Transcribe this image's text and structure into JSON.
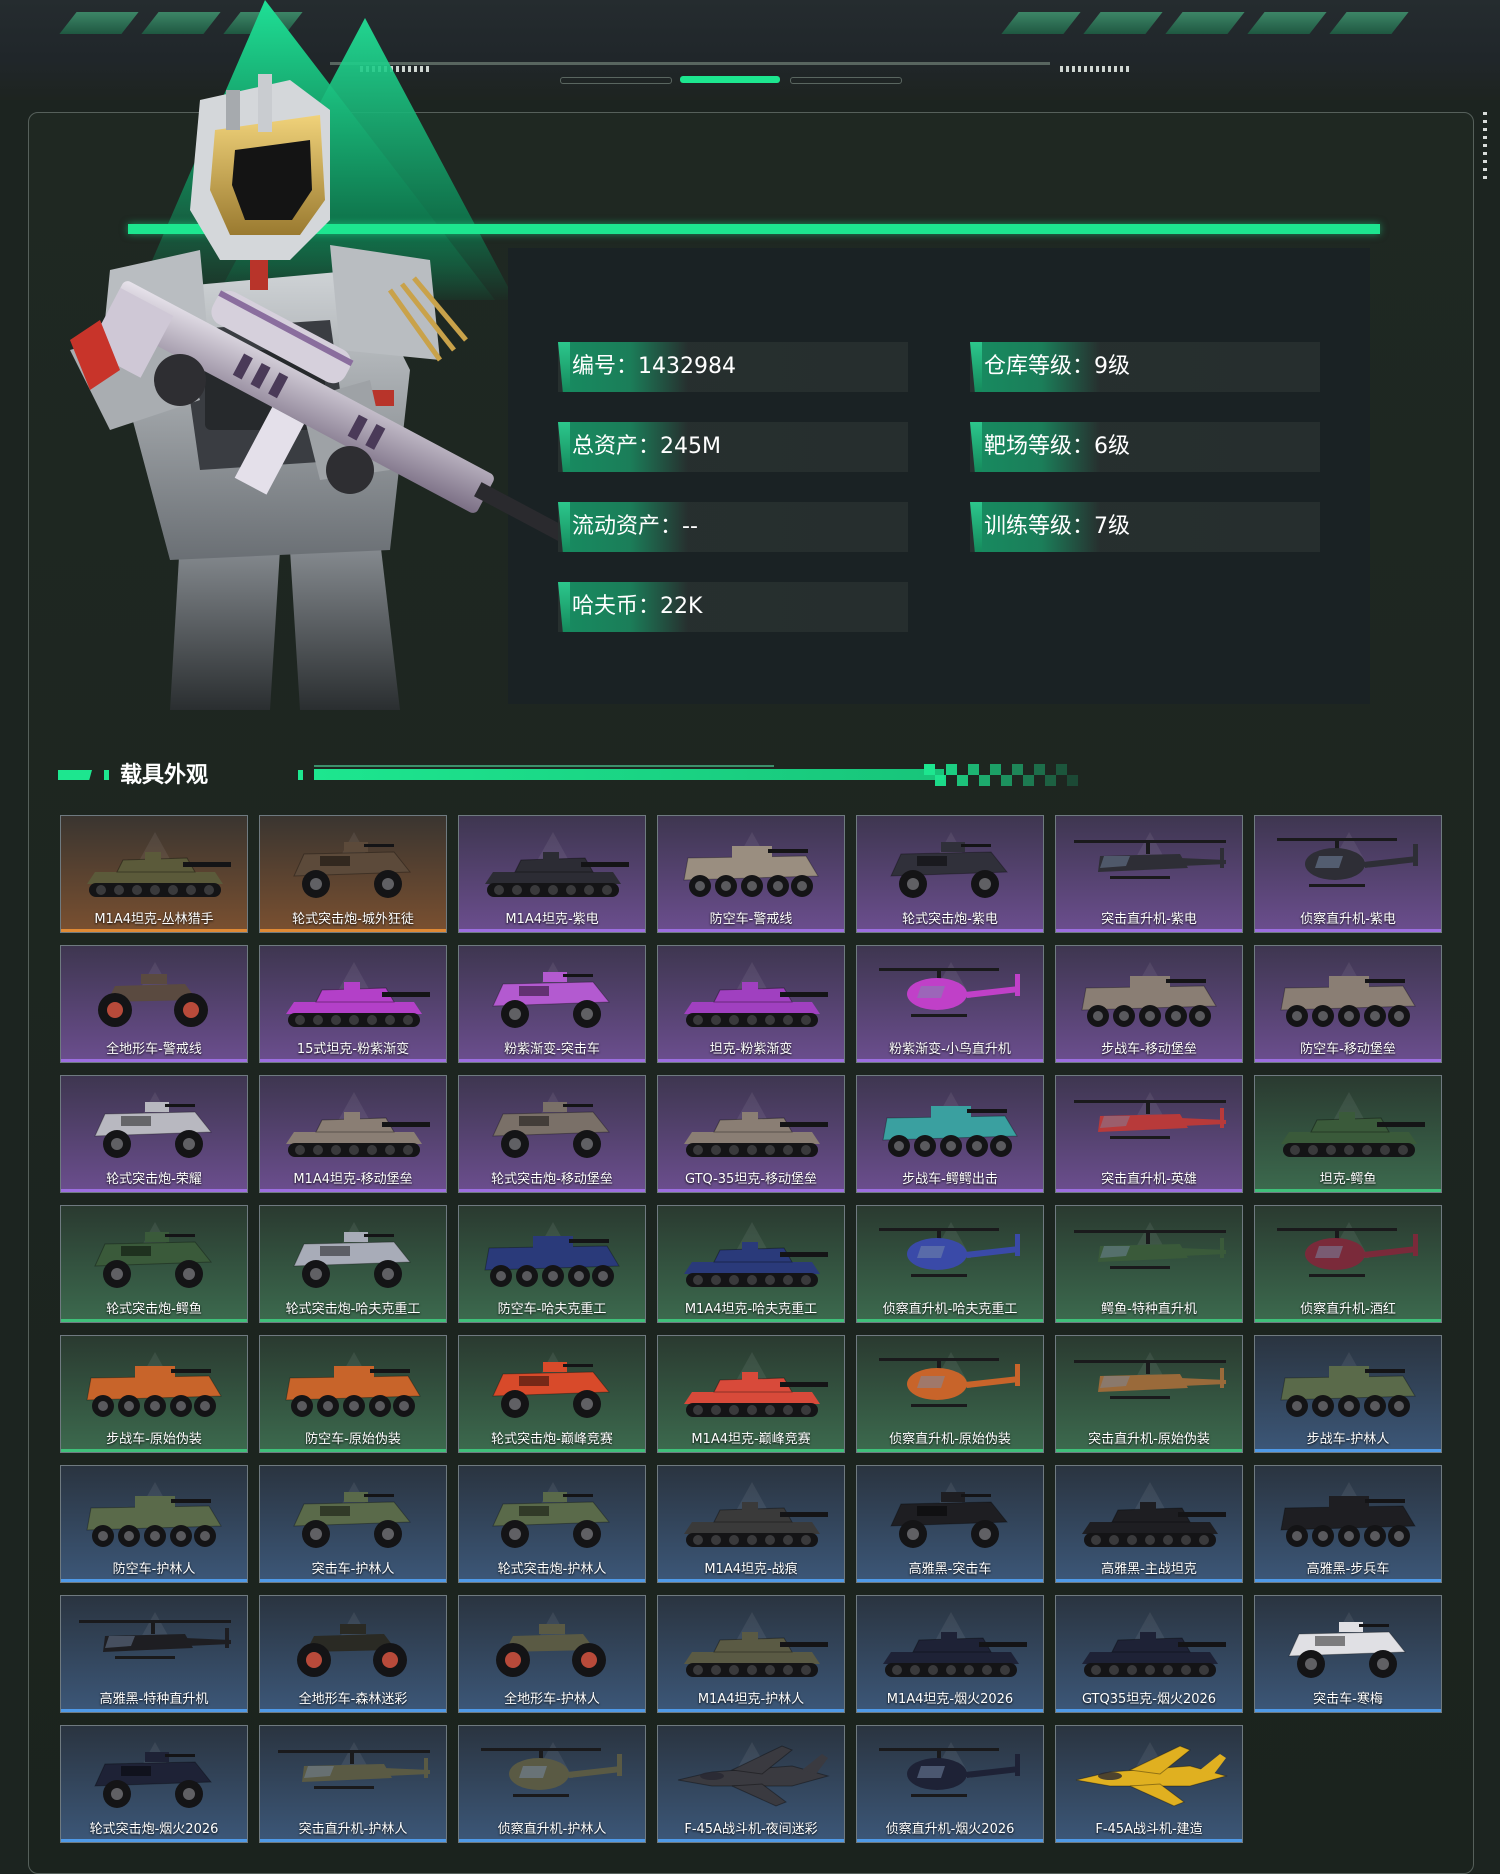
{
  "profile": {
    "stats": [
      {
        "label": "编号",
        "value": "1432984"
      },
      {
        "label": "仓库等级",
        "value": "9级"
      },
      {
        "label": "总资产",
        "value": "245M"
      },
      {
        "label": "靶场等级",
        "value": "6级"
      },
      {
        "label": "流动资产",
        "value": "--"
      },
      {
        "label": "训练等级",
        "value": "7级"
      },
      {
        "label": "哈夫币",
        "value": "22K"
      }
    ],
    "separator": "："
  },
  "section": {
    "title": "载具外观"
  },
  "colors": {
    "accent": "#1de68f",
    "rarity": {
      "orange": {
        "bg_top": "#3a3530",
        "bg_bottom": "#7a5030",
        "line": "#e08a35"
      },
      "purple": {
        "bg_top": "#3e3650",
        "bg_bottom": "#6b4e8e",
        "line": "#9c6ee0"
      },
      "green": {
        "bg_top": "#2a3a30",
        "bg_bottom": "#3c6a4e",
        "line": "#3fc07a"
      },
      "blue": {
        "bg_top": "#2a3440",
        "bg_bottom": "#3c5778",
        "line": "#4f9ae8"
      }
    }
  },
  "vehicles": [
    {
      "name": "M1A4坦克-丛林猎手",
      "rarity": "orange",
      "kind": "tank",
      "tint": "#5b5a3a"
    },
    {
      "name": "轮式突击炮-城外狂徒",
      "rarity": "orange",
      "kind": "armored",
      "tint": "#5c4a3a"
    },
    {
      "name": "M1A4坦克-紫电",
      "rarity": "purple",
      "kind": "tank",
      "tint": "#2c2c34"
    },
    {
      "name": "防空车-警戒线",
      "rarity": "purple",
      "kind": "apc",
      "tint": "#9a8e80"
    },
    {
      "name": "轮式突击炮-紫电",
      "rarity": "purple",
      "kind": "armored",
      "tint": "#30303a"
    },
    {
      "name": "突击直升机-紫电",
      "rarity": "purple",
      "kind": "heli",
      "tint": "#2e2e36"
    },
    {
      "name": "侦察直升机-紫电",
      "rarity": "purple",
      "kind": "heli_small",
      "tint": "#2e2e36"
    },
    {
      "name": "全地形车-警戒线",
      "rarity": "purple",
      "kind": "atv",
      "tint": "#5a4a40"
    },
    {
      "name": "15式坦克-粉紫渐变",
      "rarity": "purple",
      "kind": "tank",
      "tint": "#b340c8"
    },
    {
      "name": "粉紫渐变-突击车",
      "rarity": "purple",
      "kind": "armored",
      "tint": "#b35ad0"
    },
    {
      "name": "坦克-粉紫渐变",
      "rarity": "purple",
      "kind": "tank",
      "tint": "#a040c0"
    },
    {
      "name": "粉紫渐变-小鸟直升机",
      "rarity": "purple",
      "kind": "heli_small",
      "tint": "#c040c8"
    },
    {
      "name": "步战车-移动堡垒",
      "rarity": "purple",
      "kind": "apc",
      "tint": "#8a7e74"
    },
    {
      "name": "防空车-移动堡垒",
      "rarity": "purple",
      "kind": "apc",
      "tint": "#8a7e74"
    },
    {
      "name": "轮式突击炮-荣耀",
      "rarity": "purple",
      "kind": "armored",
      "tint": "#b8b8c0"
    },
    {
      "name": "M1A4坦克-移动堡垒",
      "rarity": "purple",
      "kind": "tank",
      "tint": "#8a7e74"
    },
    {
      "name": "轮式突击炮-移动堡垒",
      "rarity": "purple",
      "kind": "armored",
      "tint": "#7a7068"
    },
    {
      "name": "GTQ-35坦克-移动堡垒",
      "rarity": "purple",
      "kind": "tank",
      "tint": "#8a7e74"
    },
    {
      "name": "步战车-鳄鳄出击",
      "rarity": "purple",
      "kind": "apc",
      "tint": "#3aa0a0"
    },
    {
      "name": "突击直升机-英雄",
      "rarity": "purple",
      "kind": "heli",
      "tint": "#b83a3a"
    },
    {
      "name": "坦克-鳄鱼",
      "rarity": "green",
      "kind": "tank",
      "tint": "#3a5a3a"
    },
    {
      "name": "轮式突击炮-鳄鱼",
      "rarity": "green",
      "kind": "armored",
      "tint": "#3a5a3a"
    },
    {
      "name": "轮式突击炮-哈夫克重工",
      "rarity": "green",
      "kind": "armored",
      "tint": "#a8acb8"
    },
    {
      "name": "防空车-哈夫克重工",
      "rarity": "green",
      "kind": "apc",
      "tint": "#2a3a7a"
    },
    {
      "name": "M1A4坦克-哈夫克重工",
      "rarity": "green",
      "kind": "tank",
      "tint": "#2a3a7a"
    },
    {
      "name": "侦察直升机-哈夫克重工",
      "rarity": "green",
      "kind": "heli_small",
      "tint": "#3a4aa8"
    },
    {
      "name": "鳄鱼-特种直升机",
      "rarity": "green",
      "kind": "heli",
      "tint": "#3a5a3a"
    },
    {
      "name": "侦察直升机-酒红",
      "rarity": "green",
      "kind": "heli_small",
      "tint": "#7a2a3a"
    },
    {
      "name": "步战车-原始伪装",
      "rarity": "green",
      "kind": "apc",
      "tint": "#c8642a"
    },
    {
      "name": "防空车-原始伪装",
      "rarity": "green",
      "kind": "apc",
      "tint": "#c8642a"
    },
    {
      "name": "轮式突击炮-巅峰竞赛",
      "rarity": "green",
      "kind": "armored",
      "tint": "#d84a2a"
    },
    {
      "name": "M1A4坦克-巅峰竞赛",
      "rarity": "green",
      "kind": "tank",
      "tint": "#d84a3a"
    },
    {
      "name": "侦察直升机-原始伪装",
      "rarity": "green",
      "kind": "heli_small",
      "tint": "#c8642a"
    },
    {
      "name": "突击直升机-原始伪装",
      "rarity": "green",
      "kind": "heli",
      "tint": "#9a6a3a"
    },
    {
      "name": "步战车-护林人",
      "rarity": "blue",
      "kind": "apc",
      "tint": "#5a6a4a"
    },
    {
      "name": "防空车-护林人",
      "rarity": "blue",
      "kind": "apc",
      "tint": "#5a6a4a"
    },
    {
      "name": "突击车-护林人",
      "rarity": "blue",
      "kind": "armored",
      "tint": "#5a6a4a"
    },
    {
      "name": "轮式突击炮-护林人",
      "rarity": "blue",
      "kind": "armored",
      "tint": "#5a6a4a"
    },
    {
      "name": "M1A4坦克-战痕",
      "rarity": "blue",
      "kind": "tank",
      "tint": "#3a3a3a"
    },
    {
      "name": "高雅黑-突击车",
      "rarity": "blue",
      "kind": "armored",
      "tint": "#1e1e22"
    },
    {
      "name": "高雅黑-主战坦克",
      "rarity": "blue",
      "kind": "tank",
      "tint": "#1e1e22"
    },
    {
      "name": "高雅黑-步兵车",
      "rarity": "blue",
      "kind": "apc",
      "tint": "#1e1e22"
    },
    {
      "name": "高雅黑-特种直升机",
      "rarity": "blue",
      "kind": "heli",
      "tint": "#1e1e22"
    },
    {
      "name": "全地形车-森林迷彩",
      "rarity": "blue",
      "kind": "atv",
      "tint": "#2a2a24"
    },
    {
      "name": "全地形车-护林人",
      "rarity": "blue",
      "kind": "atv",
      "tint": "#5a5a44"
    },
    {
      "name": "M1A4坦克-护林人",
      "rarity": "blue",
      "kind": "tank",
      "tint": "#5a5a44"
    },
    {
      "name": "M1A4坦克-烟火2026",
      "rarity": "blue",
      "kind": "tank",
      "tint": "#1e2236"
    },
    {
      "name": "GTQ35坦克-烟火2026",
      "rarity": "blue",
      "kind": "tank",
      "tint": "#1e2236"
    },
    {
      "name": "突击车-寒梅",
      "rarity": "blue",
      "kind": "armored",
      "tint": "#e0e0e4"
    },
    {
      "name": "轮式突击炮-烟火2026",
      "rarity": "blue",
      "kind": "armored",
      "tint": "#1e2236"
    },
    {
      "name": "突击直升机-护林人",
      "rarity": "blue",
      "kind": "heli",
      "tint": "#5a5a44"
    },
    {
      "name": "侦察直升机-护林人",
      "rarity": "blue",
      "kind": "heli_small",
      "tint": "#5a5a44"
    },
    {
      "name": "F-45A战斗机-夜间迷彩",
      "rarity": "blue",
      "kind": "jet",
      "tint": "#3a3a40"
    },
    {
      "name": "侦察直升机-烟火2026",
      "rarity": "blue",
      "kind": "heli_small",
      "tint": "#1e2236"
    },
    {
      "name": "F-45A战斗机-建造",
      "rarity": "blue",
      "kind": "jet",
      "tint": "#e0b020"
    }
  ]
}
